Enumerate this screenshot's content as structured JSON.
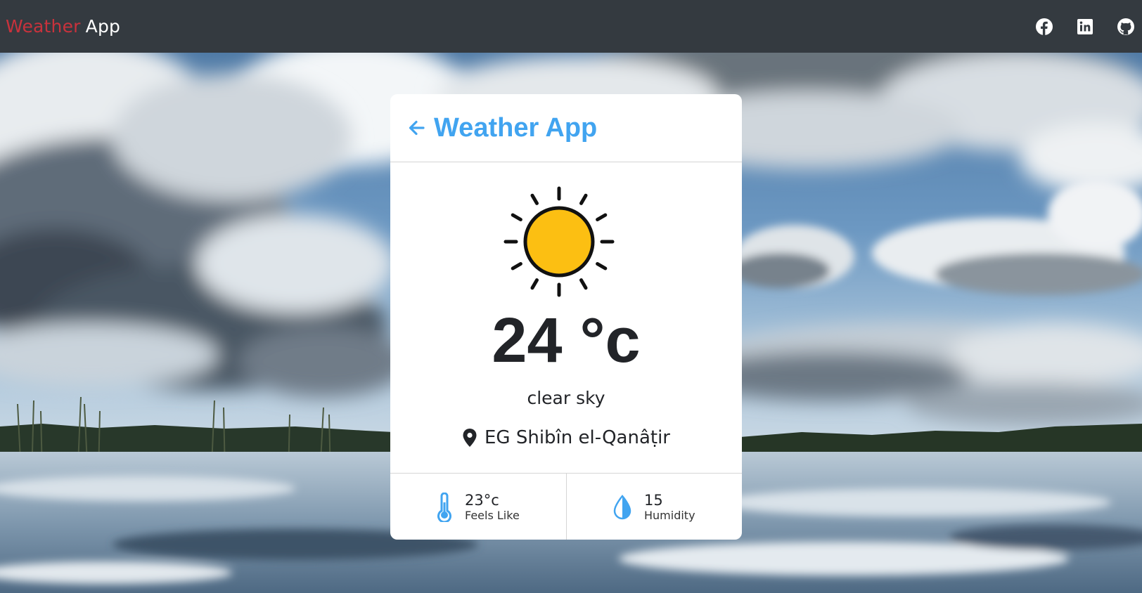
{
  "navbar": {
    "brand_part1": "Weather",
    "brand_part2": "App",
    "social_icons": [
      "facebook-icon",
      "linkedin-icon",
      "github-icon"
    ]
  },
  "card": {
    "title": "Weather App",
    "condition_icon": "sun-icon",
    "temperature": "24 °c",
    "description": "clear sky",
    "location": "EG Shibîn el-Qanâṭir",
    "feels_like": {
      "value": "23°c",
      "label": "Feels Like",
      "icon": "thermometer-icon"
    },
    "humidity": {
      "value": "15",
      "label": "Humidity",
      "icon": "droplet-icon"
    }
  },
  "colors": {
    "navbar_bg": "#343a40",
    "brand_accent": "#c8323c",
    "title_blue": "#41a4f0",
    "sun_yellow": "#fcbf12",
    "text_dark": "#222428"
  }
}
